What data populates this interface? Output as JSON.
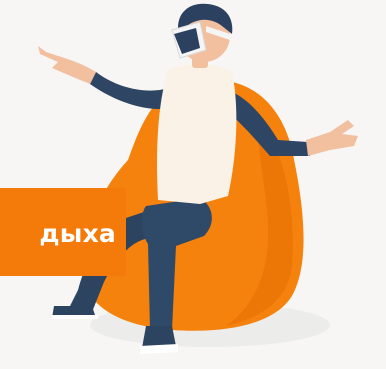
{
  "banner": {
    "text": "дыха"
  },
  "colors": {
    "background": "#f7f6f5",
    "banner": "#f47a09",
    "beanbag": "#f6820e",
    "beanbag_shadow": "#e56f00",
    "pants": "#2d4461",
    "sleeves": "#2f4564",
    "shirt": "#faf1e7",
    "skin": "#f2bf9f",
    "hair": "#2c4160",
    "vr_headset": "#f5f5f5",
    "shoe": "#2d4461"
  },
  "icons": {
    "person": "person-with-vr-headset",
    "chair": "beanbag-chair"
  }
}
